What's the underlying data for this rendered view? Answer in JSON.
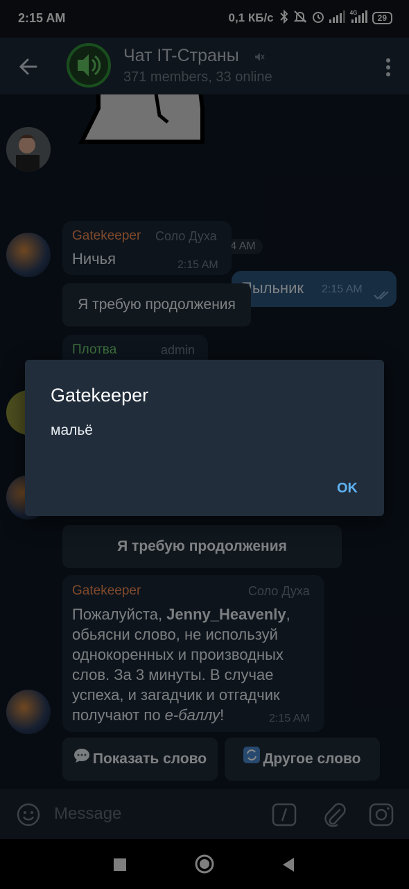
{
  "status_bar": {
    "time": "2:15 AM",
    "speed": "0,1 КБ/с",
    "network": "4G",
    "battery": "29",
    "icons": [
      "bluetooth-icon",
      "mute-bell-icon",
      "alarm-icon",
      "signal-icon",
      "signal-icon",
      "battery-icon"
    ]
  },
  "header": {
    "title": "Чат IT-Страны",
    "subtitle": "371 members, 33 online",
    "avatar_icon": "speaker-it-icon"
  },
  "messages": {
    "sticker_time": "2:14 AM",
    "outgoing": {
      "text": "Пыльник",
      "time": "2:15 AM"
    },
    "msg1": {
      "sender": "Gatekeeper",
      "role": "Соло Духа",
      "text": "Ничья",
      "time": "2:15 AM"
    },
    "button1": "Я требую продолжения",
    "msg2": {
      "sender": "Плотва",
      "role": "admin"
    },
    "button2": "Я требую продолжения",
    "msg3": {
      "sender": "Gatekeeper",
      "role": "Соло Духа",
      "line1_pre": "Пожалуйста, ",
      "line1_bold": "Jenny_Heavenly",
      "line1_post": ",",
      "line2": "обьясни слово, не используй",
      "line3": "однокоренных и производных",
      "line4": "слов. За 3 минуты. В случае",
      "line5": "успеха, и загадчик и отгадчик",
      "line6_pre": "получают по ",
      "line6_em": "е-баллу",
      "line6_post": "!",
      "time": "2:15 AM"
    },
    "show_word": "Показать слово",
    "other_word": "Другое слово"
  },
  "composer": {
    "placeholder": "Message"
  },
  "dialog": {
    "title": "Gatekeeper",
    "body": "мальё",
    "ok": "OK"
  },
  "colors": {
    "accent": "#5fb2f0",
    "name_orange": "#e9864f",
    "name_green": "#6ec96e",
    "bubble_out": "#2b5278"
  }
}
